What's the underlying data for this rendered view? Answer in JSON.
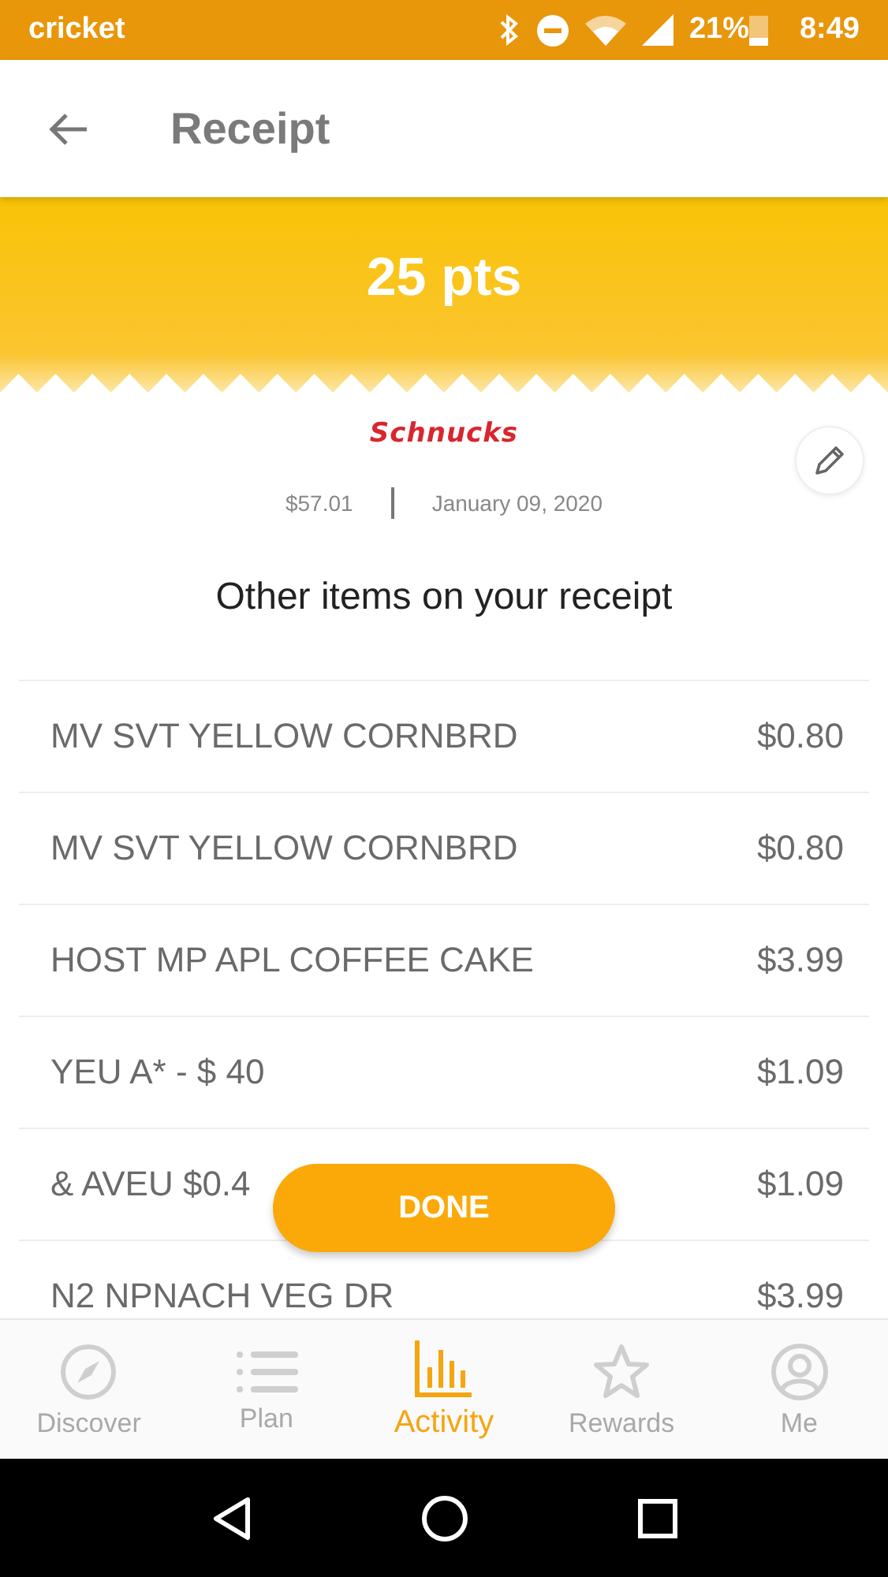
{
  "status_bar": {
    "carrier": "cricket",
    "battery": "21%",
    "time": "8:49"
  },
  "app_bar": {
    "title": "Receipt"
  },
  "banner": {
    "points": "25 pts"
  },
  "receipt": {
    "store": "Schnucks",
    "total": "$57.01",
    "date": "January 09, 2020"
  },
  "heading": "Other items on your receipt",
  "items": [
    {
      "name": "MV SVT YELLOW CORNBRD",
      "price": "$0.80"
    },
    {
      "name": "MV SVT YELLOW CORNBRD",
      "price": "$0.80"
    },
    {
      "name": "HOST MP APL COFFEE CAKE",
      "price": "$3.99"
    },
    {
      "name": "YEU A* - $ 40",
      "price": "$1.09"
    },
    {
      "name": "& AVEU $0.4",
      "price": "$1.09"
    },
    {
      "name": "N2 NPNACH VEG DR",
      "price": "$3.99"
    }
  ],
  "done_button": "DONE",
  "bottom_nav": [
    {
      "kind": "compass",
      "label": "Discover",
      "selected": false
    },
    {
      "kind": "list",
      "label": "Plan",
      "selected": false
    },
    {
      "kind": "chart",
      "label": "Activity",
      "selected": true
    },
    {
      "kind": "star",
      "label": "Rewards",
      "selected": false
    },
    {
      "kind": "person",
      "label": "Me",
      "selected": false
    }
  ]
}
